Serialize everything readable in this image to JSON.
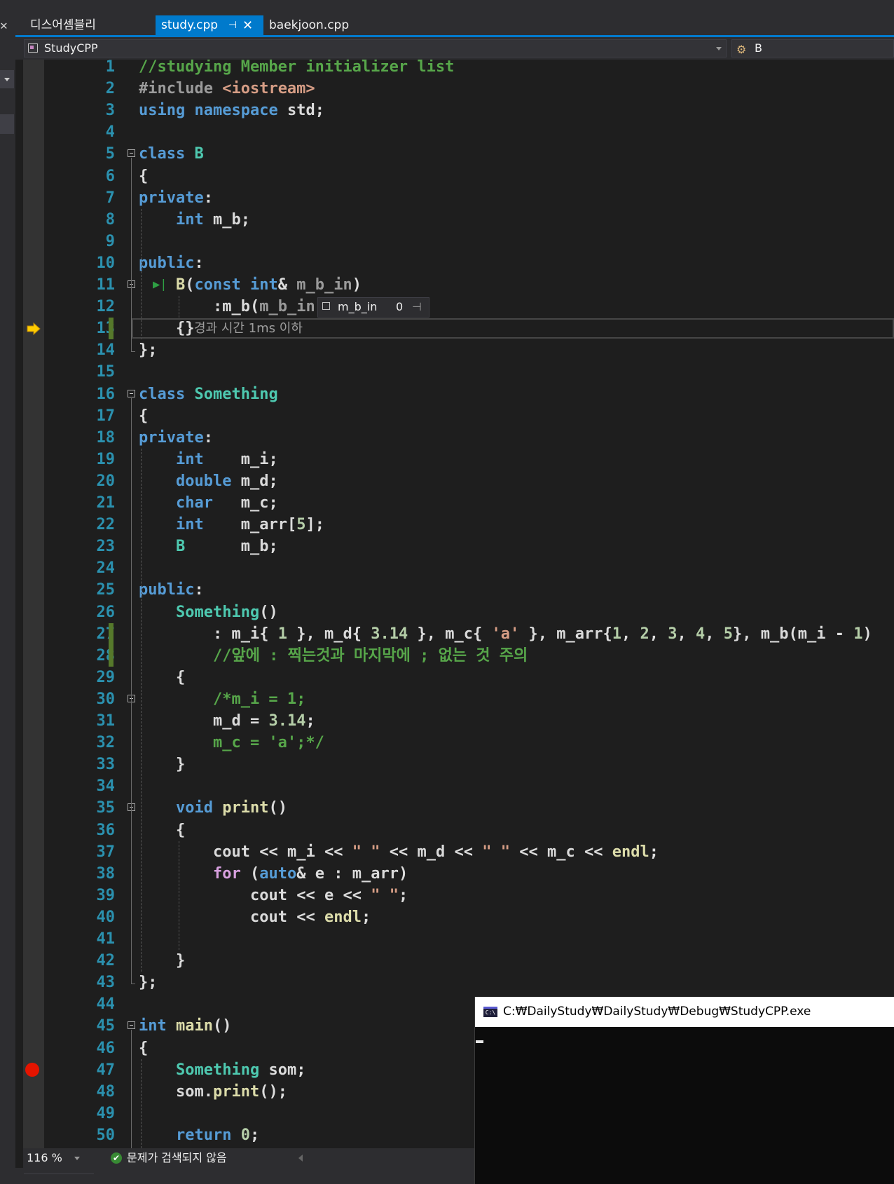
{
  "left_panel": {
    "close_glyph": "✕"
  },
  "tabs": [
    {
      "label": "디스어셈블리",
      "active": false
    },
    {
      "label": "study.cpp",
      "active": true,
      "pin": "⊣",
      "close": "✕"
    },
    {
      "label": "baekjoon.cpp",
      "active": false
    }
  ],
  "navbar": {
    "project": "StudyCPP",
    "scope": "B"
  },
  "datatip": {
    "name": "m_b_in",
    "value": "0"
  },
  "codelens": {
    "elapsed": "경과 시간 1ms 이하"
  },
  "code_lines": [
    [
      "1",
      "//studying Member initializer list"
    ],
    [
      "2",
      "#include <iostream>"
    ],
    [
      "3",
      "using namespace std;"
    ],
    [
      "4",
      ""
    ],
    [
      "5",
      "class B"
    ],
    [
      "6",
      "{"
    ],
    [
      "7",
      "private:"
    ],
    [
      "8",
      "    int m_b;"
    ],
    [
      "9",
      ""
    ],
    [
      "10",
      "public:"
    ],
    [
      "11",
      "    B(const int& m_b_in)"
    ],
    [
      "12",
      "        :m_b(m_b_in)"
    ],
    [
      "13",
      "    {}"
    ],
    [
      "14",
      "};"
    ],
    [
      "15",
      ""
    ],
    [
      "16",
      "class Something"
    ],
    [
      "17",
      "{"
    ],
    [
      "18",
      "private:"
    ],
    [
      "19",
      "    int    m_i;"
    ],
    [
      "20",
      "    double m_d;"
    ],
    [
      "21",
      "    char   m_c;"
    ],
    [
      "22",
      "    int    m_arr[5];"
    ],
    [
      "23",
      "    B      m_b;"
    ],
    [
      "24",
      ""
    ],
    [
      "25",
      "public:"
    ],
    [
      "26",
      "    Something()"
    ],
    [
      "27",
      "        : m_i{ 1 }, m_d{ 3.14 }, m_c{ 'a' }, m_arr{1, 2, 3, 4, 5}, m_b(m_i - 1)"
    ],
    [
      "28",
      "        //앞에 : 찍는것과 마지막에 ; 없는 것 주의"
    ],
    [
      "29",
      "    {"
    ],
    [
      "30",
      "        /*m_i = 1;"
    ],
    [
      "31",
      "        m_d = 3.14;"
    ],
    [
      "32",
      "        m_c = 'a';*/"
    ],
    [
      "33",
      "    }"
    ],
    [
      "34",
      ""
    ],
    [
      "35",
      "    void print()"
    ],
    [
      "36",
      "    {"
    ],
    [
      "37",
      "        cout << m_i << \" \" << m_d << \" \" << m_c << endl;"
    ],
    [
      "38",
      "        for (auto& e : m_arr)"
    ],
    [
      "39",
      "            cout << e << \" \";"
    ],
    [
      "40",
      "            cout << endl;"
    ],
    [
      "41",
      ""
    ],
    [
      "42",
      "    }"
    ],
    [
      "43",
      "};"
    ],
    [
      "44",
      ""
    ],
    [
      "45",
      "int main()"
    ],
    [
      "46",
      "{"
    ],
    [
      "47",
      "    Something som;"
    ],
    [
      "48",
      "    som.print();"
    ],
    [
      "49",
      ""
    ],
    [
      "50",
      "    return 0;"
    ]
  ],
  "statusbar": {
    "zoom": "116 %",
    "issues": "문제가 검색되지 않음"
  },
  "console": {
    "title": "C:₩DailyStudy₩DailyStudy₩Debug₩StudyCPP.exe",
    "icon_text": "C:\\"
  },
  "debugger": {
    "current_line": 13,
    "breakpoint_line": 47
  },
  "icons": {
    "execution_pointer": "yellow-arrow-icon",
    "breakpoint": "red-dot-icon",
    "run_to_click": "green-play-icon"
  },
  "colors": {
    "keyword": "#569cd6",
    "type": "#4ec9b0",
    "function": "#dcdcaa",
    "comment": "#57a64a",
    "string": "#d69d85",
    "number": "#b5cea8",
    "line_number": "#2b91af",
    "accent": "#007acc"
  }
}
